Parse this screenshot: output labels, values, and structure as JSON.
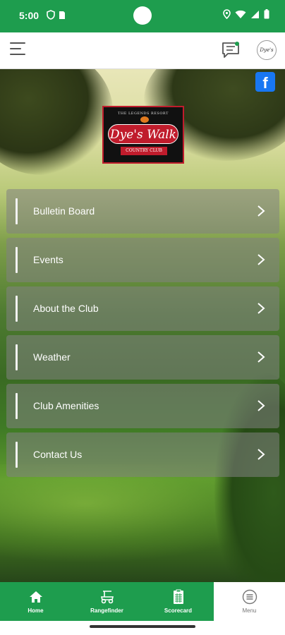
{
  "status_bar": {
    "time": "5:00"
  },
  "header": {
    "club_badge_text": "Dye's"
  },
  "social": {
    "facebook_letter": "f"
  },
  "logo": {
    "top_text": "THE LEGENDS RESORT",
    "name": "Dye's Walk",
    "sub_text": "COUNTRY CLUB"
  },
  "menu": {
    "items": [
      {
        "label": "Bulletin Board"
      },
      {
        "label": "Events"
      },
      {
        "label": "About the Club"
      },
      {
        "label": "Weather"
      },
      {
        "label": "Club Amenities"
      },
      {
        "label": "Contact Us"
      }
    ]
  },
  "bottom_nav": {
    "items": [
      {
        "label": "Home",
        "icon": "home-icon"
      },
      {
        "label": "Rangefinder",
        "icon": "golf-cart-icon"
      },
      {
        "label": "Scorecard",
        "icon": "scorecard-icon"
      },
      {
        "label": "Menu",
        "icon": "menu-circle-icon"
      }
    ]
  },
  "colors": {
    "brand_green": "#1e9d4e",
    "facebook_blue": "#1877f2",
    "logo_red": "#c01c2c"
  }
}
